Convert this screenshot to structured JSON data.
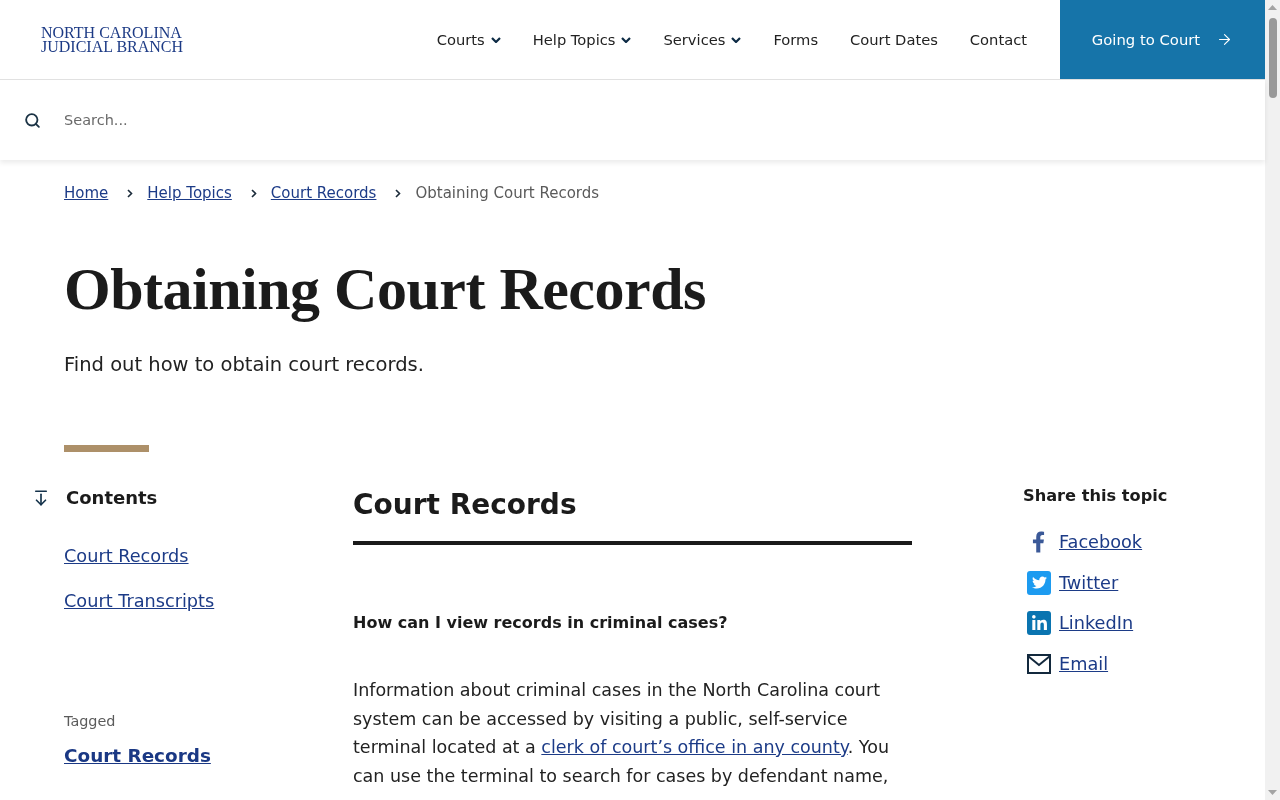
{
  "header": {
    "logo": [
      "NORTH CAROLINA",
      "JUDICIAL BRANCH"
    ],
    "nav": [
      {
        "label": "Courts",
        "has_menu": true
      },
      {
        "label": "Help Topics",
        "has_menu": true
      },
      {
        "label": "Services",
        "has_menu": true
      },
      {
        "label": "Forms",
        "has_menu": false
      },
      {
        "label": "Court Dates",
        "has_menu": false
      },
      {
        "label": "Contact",
        "has_menu": false
      }
    ],
    "cta": "Going to Court"
  },
  "search": {
    "placeholder": "Search..."
  },
  "breadcrumb": [
    {
      "label": "Home",
      "current": false
    },
    {
      "label": "Help Topics",
      "current": false
    },
    {
      "label": "Court Records",
      "current": false
    },
    {
      "label": "Obtaining Court Records",
      "current": true
    }
  ],
  "page": {
    "title": "Obtaining Court Records",
    "summary": "Find out how to obtain court records."
  },
  "contents": {
    "title": "Contents",
    "items": [
      "Court Records",
      "Court Transcripts"
    ]
  },
  "tagged": {
    "label": "Tagged",
    "tags": [
      "Court Records"
    ]
  },
  "article": {
    "heading": "Court Records",
    "question": "How can I view records in criminal cases?",
    "paragraph": [
      {
        "kind": "text",
        "text": "Information about criminal cases in the North Carolina court system can be accessed by visiting a public, self-service terminal located at a "
      },
      {
        "kind": "link",
        "text": "clerk of court’s office in any county"
      },
      {
        "kind": "text",
        "text": ". You can use the terminal to search for cases by defendant name,"
      }
    ]
  },
  "share": {
    "title": "Share this topic",
    "items": [
      {
        "kind": "facebook",
        "label": "Facebook"
      },
      {
        "kind": "twitter",
        "label": "Twitter"
      },
      {
        "kind": "linkedin",
        "label": "LinkedIn"
      },
      {
        "kind": "email",
        "label": "Email"
      }
    ]
  }
}
